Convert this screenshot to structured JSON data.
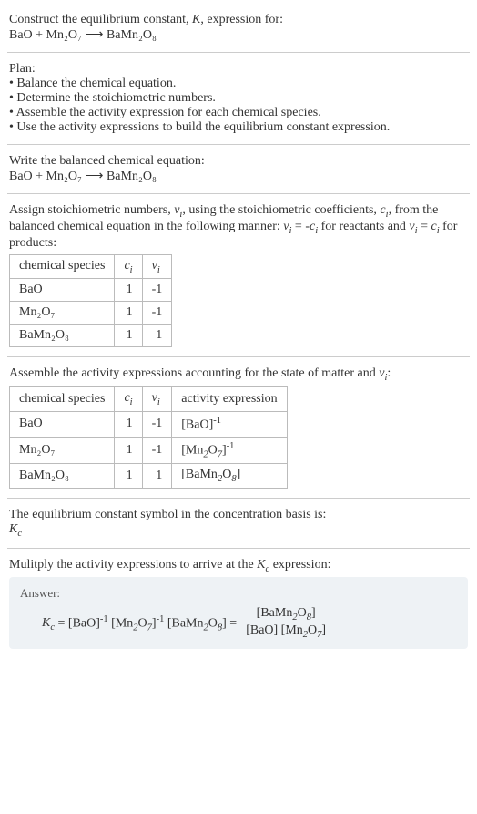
{
  "header": {
    "prompt": "Construct the equilibrium constant, K, expression for:",
    "equation": "BaO + Mn₂O₇  ⟶  BaMn₂O₈"
  },
  "plan": {
    "title": "Plan:",
    "b1": "• Balance the chemical equation.",
    "b2": "• Determine the stoichiometric numbers.",
    "b3": "• Assemble the activity expression for each chemical species.",
    "b4": "• Use the activity expressions to build the equilibrium constant expression."
  },
  "balanced": {
    "title": "Write the balanced chemical equation:",
    "equation": "BaO + Mn₂O₇  ⟶  BaMn₂O₈"
  },
  "assign": {
    "text": "Assign stoichiometric numbers, νᵢ, using the stoichiometric coefficients, cᵢ, from the balanced chemical equation in the following manner: νᵢ = -cᵢ for reactants and νᵢ = cᵢ for products:"
  },
  "table1": {
    "h_species": "chemical species",
    "h_c": "cᵢ",
    "h_v": "νᵢ",
    "r1_s": "BaO",
    "r1_c": "1",
    "r1_v": "-1",
    "r2_s": "Mn₂O₇",
    "r2_c": "1",
    "r2_v": "-1",
    "r3_s": "BaMn₂O₈",
    "r3_c": "1",
    "r3_v": "1"
  },
  "assemble": {
    "text": "Assemble the activity expressions accounting for the state of matter and νᵢ:"
  },
  "table2": {
    "h_species": "chemical species",
    "h_c": "cᵢ",
    "h_v": "νᵢ",
    "h_act": "activity expression",
    "r1_s": "BaO",
    "r1_c": "1",
    "r1_v": "-1",
    "r1_a": "[BaO]⁻¹",
    "r2_s": "Mn₂O₇",
    "r2_c": "1",
    "r2_v": "-1",
    "r2_a": "[Mn₂O₇]⁻¹",
    "r3_s": "BaMn₂O₈",
    "r3_c": "1",
    "r3_v": "1",
    "r3_a": "[BaMn₂O₈]"
  },
  "symbol": {
    "text": "The equilibrium constant symbol in the concentration basis is:",
    "kc": "K𝒸"
  },
  "multiply": {
    "text": "Mulitply the activity expressions to arrive at the K𝒸 expression:"
  },
  "answer": {
    "label": "Answer:",
    "lhs": "K𝒸 = [BaO]⁻¹ [Mn₂O₇]⁻¹ [BaMn₂O₈] =",
    "frac_num": "[BaMn₂O₈]",
    "frac_den": "[BaO] [Mn₂O₇]"
  }
}
